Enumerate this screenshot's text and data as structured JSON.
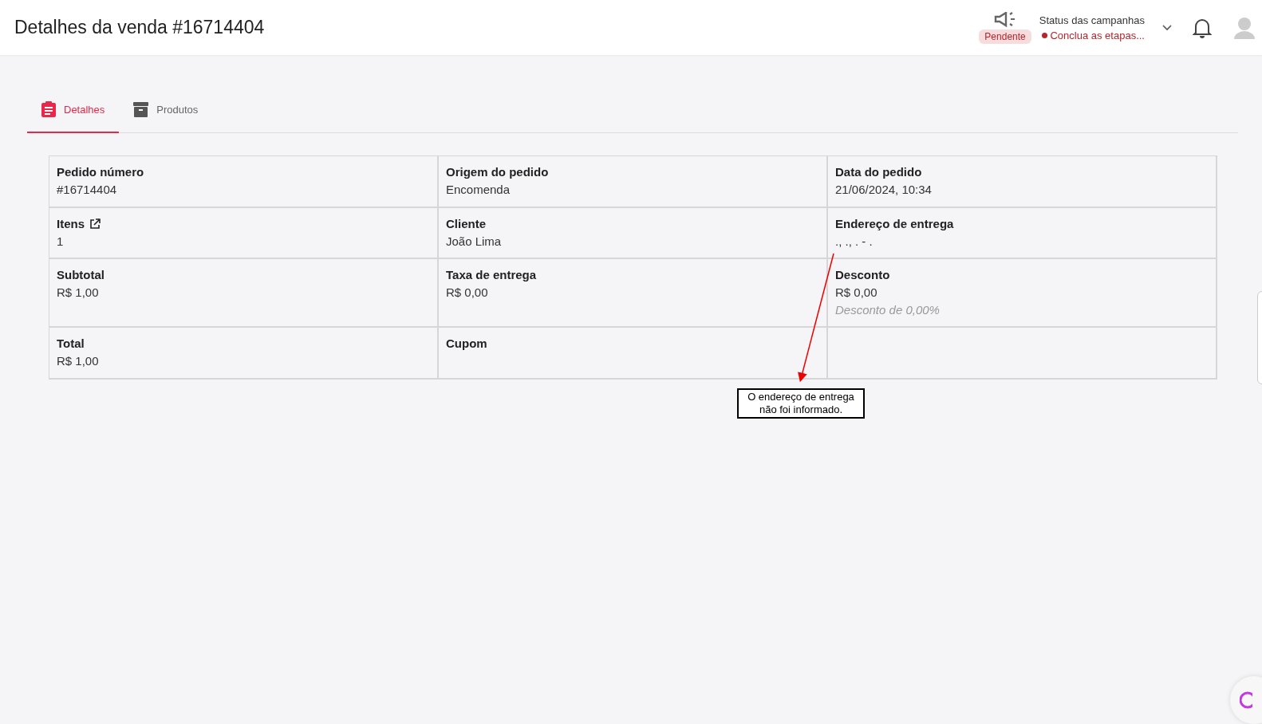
{
  "header": {
    "title": "Detalhes da venda #16714404",
    "campaign_badge": "Pendente",
    "campaign_status": {
      "title": "Status das campanhas",
      "message": "Conclua as etapas..."
    }
  },
  "tabs": [
    {
      "label": "Detalhes",
      "selected": true,
      "kind": "clipboard"
    },
    {
      "label": "Produtos",
      "selected": false,
      "kind": "archive"
    }
  ],
  "details": [
    {
      "label": "Pedido número",
      "value": "#16714404"
    },
    {
      "label": "Origem do pedido",
      "value": "Encomenda"
    },
    {
      "label": "Data do pedido",
      "value": "21/06/2024, 10:34"
    },
    {
      "label": "Itens",
      "value": "1",
      "external_link": true
    },
    {
      "label": "Cliente",
      "value": "João Lima"
    },
    {
      "label": "Endereço de entrega",
      "value": "., ., . - ."
    },
    {
      "label": "Subtotal",
      "value": "R$ 1,00"
    },
    {
      "label": "Taxa de entrega",
      "value": "R$ 0,00"
    },
    {
      "label": "Desconto",
      "value": "R$ 0,00",
      "note": "Desconto de 0,00%"
    },
    {
      "label": "Total",
      "value": "R$ 1,00"
    },
    {
      "label": "Cupom"
    }
  ],
  "annotation": {
    "text": "O endereço de entrega não foi informado."
  }
}
